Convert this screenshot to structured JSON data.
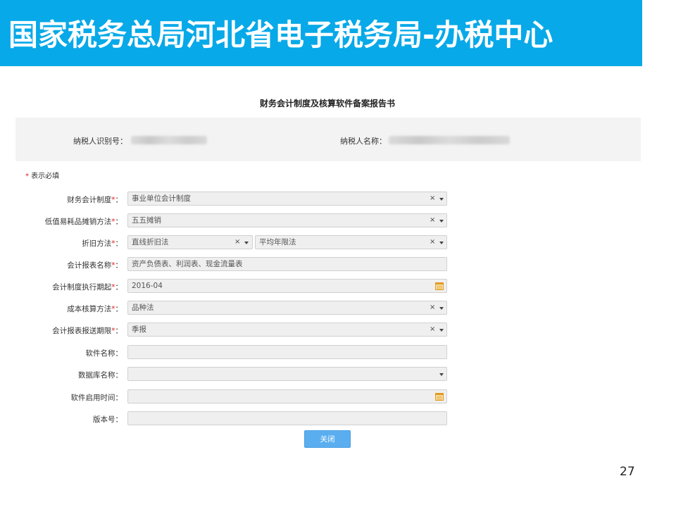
{
  "banner": {
    "title": "国家税务总局河北省电子税务局-办税中心",
    "bg_color": "#07a9e8"
  },
  "form": {
    "title": "财务会计制度及核算软件备案报告书",
    "taxpayer_id_label": "纳税人识别号：",
    "taxpayer_name_label": "纳税人名称：",
    "required_star": "*",
    "required_note": " 表示必填",
    "rows": [
      {
        "label": "财务会计制度",
        "required": true,
        "value": "事业单位会计制度"
      },
      {
        "label": "低值易耗品摊销方法",
        "required": true,
        "value": "五五摊销"
      },
      {
        "label": "折旧方法",
        "required": true,
        "value": "直线折旧法",
        "value2": "平均年限法"
      },
      {
        "label": "会计报表名称",
        "required": true,
        "value": "资产负债表、利润表、现金流量表"
      },
      {
        "label": "会计制度执行期起",
        "required": true,
        "value": "2016-04"
      },
      {
        "label": "成本核算方法",
        "required": true,
        "value": "品种法"
      },
      {
        "label": "会计报表报送期限",
        "required": true,
        "value": "季报"
      },
      {
        "label": "软件名称",
        "required": false,
        "value": ""
      },
      {
        "label": "数据库名称",
        "required": false,
        "value": ""
      },
      {
        "label": "软件启用时间",
        "required": false,
        "value": ""
      },
      {
        "label": "版本号",
        "required": false,
        "value": ""
      }
    ],
    "label_suffix": "：",
    "clear_symbol": "×",
    "close_button": "关闭"
  },
  "page_number": "27",
  "colors": {
    "required": "#e02020",
    "button": "#5aaef0",
    "calendar": "#f0a020"
  }
}
